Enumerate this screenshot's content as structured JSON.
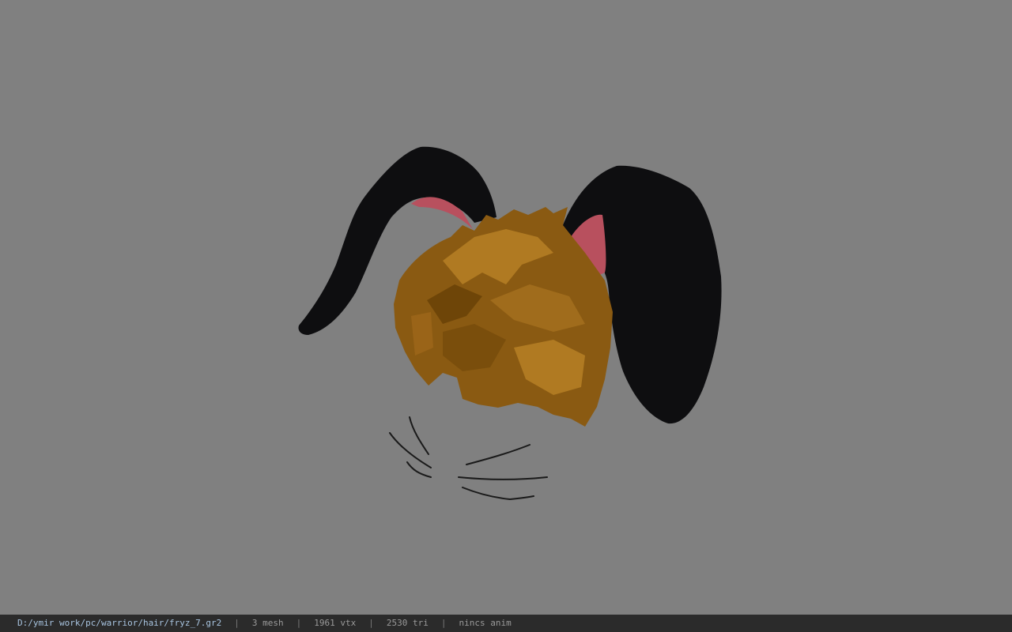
{
  "viewport": {
    "background": "#808080",
    "model": {
      "parts": [
        "hair-mesh",
        "left-ear-mesh",
        "right-ear-mesh",
        "whiskers"
      ],
      "colors": {
        "hair": "#8a5a12",
        "hair_highlight": "#b07a22",
        "ear": "#0e0e10",
        "ear_inner": "#b8505e",
        "whisker": "#1a1a1a"
      }
    }
  },
  "statusbar": {
    "file_path": "D:/ymir work/pc/warrior/hair/fryz_7.gr2",
    "mesh_count": "3 mesh",
    "vertex_count": "1961 vtx",
    "triangle_count": "2530 tri",
    "anim_status": "nincs anim",
    "separator": "|"
  }
}
